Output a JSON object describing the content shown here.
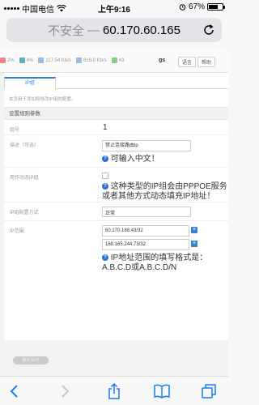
{
  "status": {
    "carrier": "中国电信",
    "time": "上午9:16",
    "battery": "67%",
    "battery_level": 0.67
  },
  "address": {
    "security": "不安全",
    "separator": "—",
    "host": "60.170.60.165"
  },
  "topbar": {
    "metrics": [
      {
        "value": "2%",
        "color": "#e88"
      },
      {
        "value": "4%",
        "color": "#6ab"
      },
      {
        "value": "117.54 Kb/s",
        "color": "#9bd"
      },
      {
        "value": "616.0 Kb/s",
        "color": "#9bd"
      },
      {
        "value": "43",
        "color": "#8c8"
      }
    ],
    "logo": "gs",
    "buttons": [
      "语言",
      "帮助"
    ]
  },
  "tabs": [
    "IP组"
  ],
  "description": "本页用于添加和修改IP组的配置。",
  "section_title": "设置规则参数",
  "form": {
    "group_id_label": "组号",
    "group_id_value": "1",
    "desc_label": "描述（可选）",
    "desc_value": "禁止连接路由ip",
    "desc_hint": "可输入中文！",
    "dynamic_label": "用作动态IP组",
    "dynamic_hint": "这种类型的IP组会由PPPOE服务或者其他方式动态填充IP地址！",
    "config_label": "IP组配置方式",
    "config_value": "正常",
    "range_label": "IP范围",
    "ranges": [
      "60.170.188.43/32",
      "188.165.244.73/32"
    ],
    "range_hint": "IP地址范围的填写格式是：A.B.C.D或A.B.C.D/N",
    "delete_icon": "×"
  },
  "save_label": "确定/保存"
}
